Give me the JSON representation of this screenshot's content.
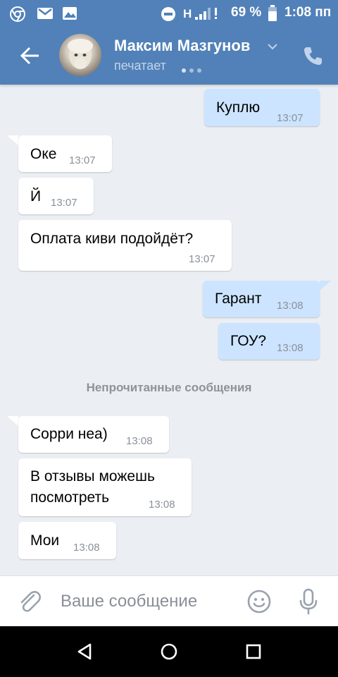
{
  "status_bar": {
    "network_type": "H",
    "battery_percent": "69 %",
    "time": "1:08 пп",
    "icons": [
      "chrome-icon",
      "gmail-icon",
      "gallery-icon",
      "do-not-disturb-icon",
      "signal-icon",
      "battery-icon"
    ]
  },
  "header": {
    "contact_name": "Максим Мазгунов",
    "status": "печатает",
    "icons": [
      "back-arrow-icon",
      "avatar",
      "chevron-down-icon",
      "phone-icon"
    ]
  },
  "messages": [
    {
      "direction": "out",
      "text": "Куплю",
      "time": "13:07"
    },
    {
      "direction": "in",
      "text": "Оке",
      "time": "13:07"
    },
    {
      "direction": "in",
      "text": "Й",
      "time": "13:07"
    },
    {
      "direction": "in",
      "text": "Оплата киви подойдёт?",
      "time": "13:07"
    },
    {
      "direction": "out",
      "text": "Гарант",
      "time": "13:08"
    },
    {
      "direction": "out",
      "text": "ГОУ?",
      "time": "13:08"
    },
    {
      "direction": "in",
      "text": "Сорри неа)",
      "time": "13:08"
    },
    {
      "direction": "in",
      "text": "В отзывы можешь",
      "text2": "посмотреть",
      "time": "13:08"
    },
    {
      "direction": "in",
      "text": "Мои",
      "time": "13:08"
    }
  ],
  "unread_divider": "Непрочитанные сообщения",
  "input_bar": {
    "placeholder": "Ваше сообщение",
    "value": "",
    "icons": [
      "paperclip-icon",
      "emoji-icon",
      "microphone-icon"
    ]
  },
  "nav_bar": {
    "icons": [
      "back-triangle-icon",
      "home-circle-icon",
      "recents-square-icon"
    ]
  },
  "colors": {
    "header_blue": "#5181b8",
    "outgoing_bubble": "#cce4ff",
    "incoming_bubble": "#ffffff",
    "chat_background": "#ebeef2"
  }
}
